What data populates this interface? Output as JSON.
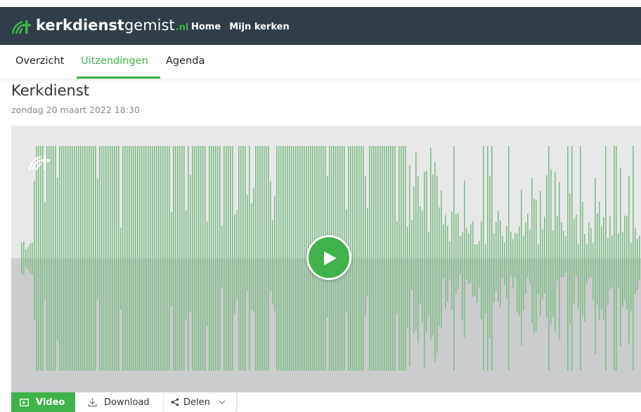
{
  "brand": {
    "name_bold": "kerkdienst",
    "name_light": "gemist",
    "tld": ".nl",
    "accent_color": "#3fb24a",
    "header_color": "#2f3e48"
  },
  "nav": {
    "items": [
      {
        "label": "Home"
      },
      {
        "label": "Mijn kerken"
      }
    ]
  },
  "tabs": [
    {
      "label": "Overzicht"
    },
    {
      "label": "Uitzendingen",
      "active": true
    },
    {
      "label": "Agenda"
    }
  ],
  "broadcast": {
    "title": "Kerkdienst",
    "date": "zondag 20 maart 2022 18:30"
  },
  "player": {
    "play_icon": "play-icon",
    "logo_icon": "kerkdienstgemist-signal-icon"
  },
  "actions": {
    "video_label": "Video",
    "download_label": "Download",
    "share_label": "Delen"
  }
}
